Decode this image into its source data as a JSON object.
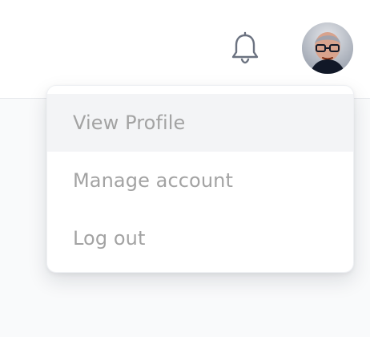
{
  "header": {
    "notification_icon": "bell-icon",
    "avatar_icon": "user-avatar"
  },
  "menu": {
    "items": [
      {
        "label": "View Profile",
        "highlighted": true
      },
      {
        "label": "Manage account",
        "highlighted": false
      },
      {
        "label": "Log out",
        "highlighted": false
      }
    ]
  },
  "colors": {
    "header_bg": "#ffffff",
    "page_bg": "#f9fafb",
    "menu_text": "#a3a3a3",
    "menu_hover_bg": "#f3f4f6",
    "icon_stroke": "#6b7280"
  }
}
